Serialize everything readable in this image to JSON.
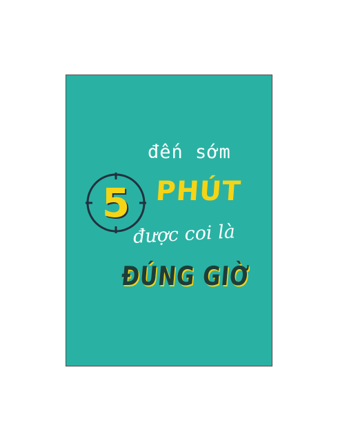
{
  "poster": {
    "line1": "đến sớm",
    "number": "5",
    "line2": "PHÚT",
    "line3": "được coi là",
    "line4": "ĐÚNG GIỜ"
  },
  "colors": {
    "background": "#29b2a3",
    "accent": "#f5d416",
    "dark": "#1e3d39",
    "text": "#ffffff"
  },
  "icons": {
    "clock": "clock-face-icon"
  }
}
